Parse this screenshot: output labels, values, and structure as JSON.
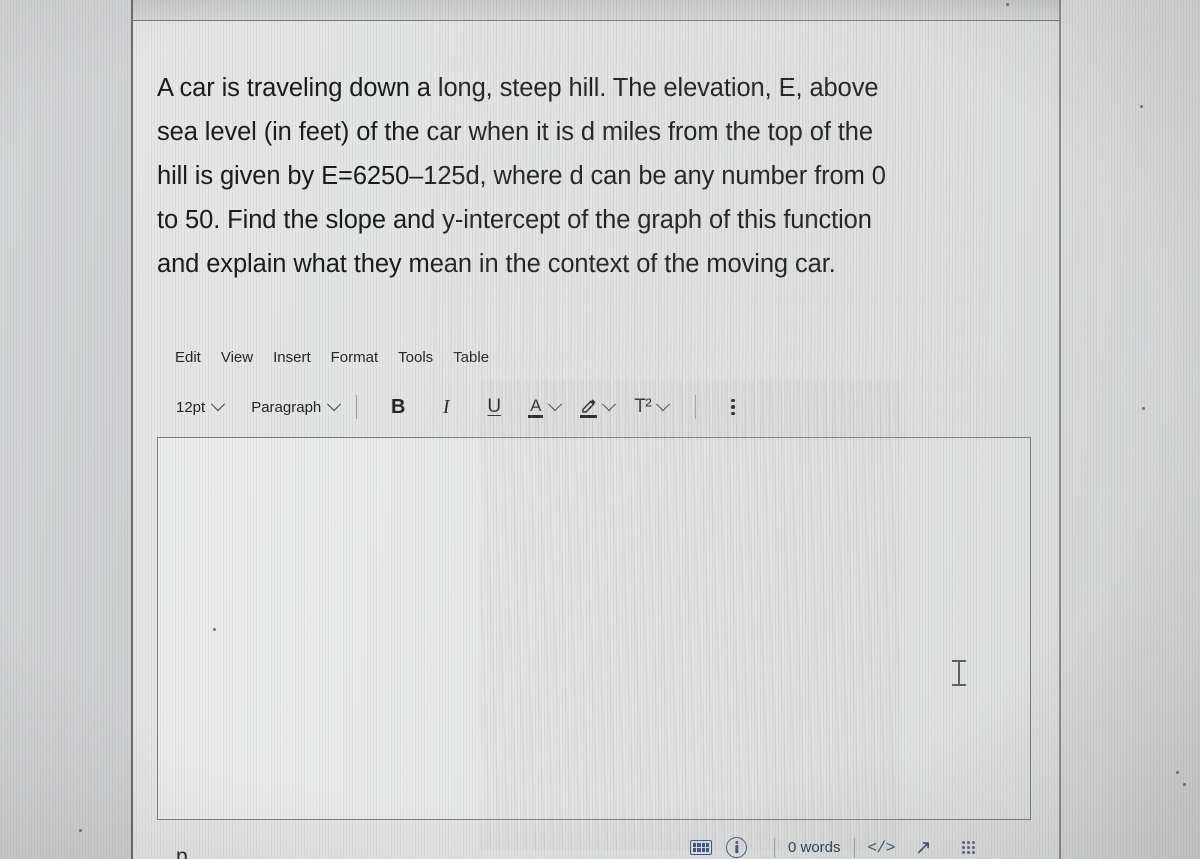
{
  "question": {
    "lines": [
      "A car is traveling down a long, steep hill. The elevation, E, above",
      "sea level (in feet) of the car when it is d miles from the top of the",
      "hill is given by E=6250–125d, where d can be any number from 0",
      "to 50. Find the slope and y-intercept of the graph of this function",
      "and explain what they mean in the context of the moving car."
    ]
  },
  "editor": {
    "menubar": [
      {
        "label": "Edit"
      },
      {
        "label": "View"
      },
      {
        "label": "Insert"
      },
      {
        "label": "Format"
      },
      {
        "label": "Tools"
      },
      {
        "label": "Table"
      }
    ],
    "toolbar": {
      "font_size": "12pt",
      "block_format": "Paragraph",
      "bold": "B",
      "italic": "I",
      "underline": "U",
      "text_color": "A",
      "highlight": "highlighter-icon",
      "superscript": "T²",
      "more": "more-options-icon"
    },
    "content": "",
    "statusbar": {
      "keyboard": "keyboard-icon",
      "accessibility": "accessibility-icon",
      "word_count": "0 words",
      "source_code": "</>",
      "expand": "↗",
      "resize": "resize-grip-icon"
    }
  },
  "page": {
    "bottom_partial_text": "p"
  },
  "colors": {
    "page_background": "#d3d4d5",
    "panel_background": "#e4e5e5",
    "editor_background": "#e8e9ea",
    "border": "#7e8183",
    "text": "#1a1c1f",
    "status_accent": "#3e5470"
  }
}
